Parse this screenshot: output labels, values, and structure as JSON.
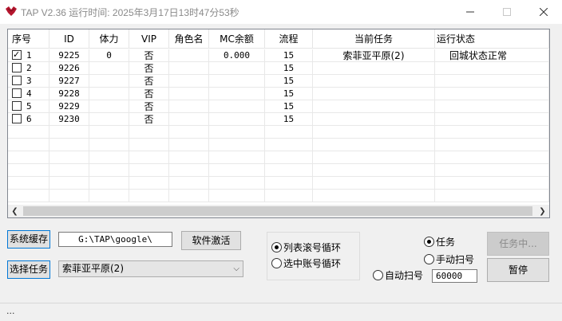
{
  "window": {
    "title": "TAP V2.36 运行时间: 2025年3月17日13时47分53秒"
  },
  "grid": {
    "columns": [
      "序号",
      "ID",
      "体力",
      "VIP",
      "角色名",
      "MC余额",
      "流程",
      "当前任务",
      "运行状态"
    ],
    "rows": [
      {
        "seq": "1",
        "checked": true,
        "id": "9225",
        "stamina": "0",
        "vip": "否",
        "role": "",
        "mc": "0.000",
        "flow": "15",
        "task": "索菲亚平原(2)",
        "status": "回城状态正常"
      },
      {
        "seq": "2",
        "checked": false,
        "id": "9226",
        "stamina": "",
        "vip": "否",
        "role": "",
        "mc": "",
        "flow": "15",
        "task": "",
        "status": ""
      },
      {
        "seq": "3",
        "checked": false,
        "id": "9227",
        "stamina": "",
        "vip": "否",
        "role": "",
        "mc": "",
        "flow": "15",
        "task": "",
        "status": ""
      },
      {
        "seq": "4",
        "checked": false,
        "id": "9228",
        "stamina": "",
        "vip": "否",
        "role": "",
        "mc": "",
        "flow": "15",
        "task": "",
        "status": ""
      },
      {
        "seq": "5",
        "checked": false,
        "id": "9229",
        "stamina": "",
        "vip": "否",
        "role": "",
        "mc": "",
        "flow": "15",
        "task": "",
        "status": ""
      },
      {
        "seq": "6",
        "checked": false,
        "id": "9230",
        "stamina": "",
        "vip": "否",
        "role": "",
        "mc": "",
        "flow": "15",
        "task": "",
        "status": ""
      }
    ]
  },
  "controls": {
    "cache_button": "系统缓存",
    "path_value": "G:\\TAP\\google\\",
    "activate_button": "软件激活",
    "select_task_button": "选择任务",
    "task_select_value": "索菲亚平原(2)",
    "loop_options": [
      {
        "label": "列表滚号循环",
        "selected": true
      },
      {
        "label": "选中账号循环",
        "selected": false
      }
    ],
    "mode_task": "任务",
    "mode_manual_scan": "手动扫号",
    "mode_auto_scan": "自动扫号",
    "auto_scan_value": "60000",
    "running_button": "任务中...",
    "pause_button": "暂停"
  },
  "statusbar": {
    "text": "..."
  },
  "icons": {
    "app": "app-logo-icon",
    "min": "minimize-icon",
    "max": "maximize-icon",
    "close": "close-icon"
  }
}
